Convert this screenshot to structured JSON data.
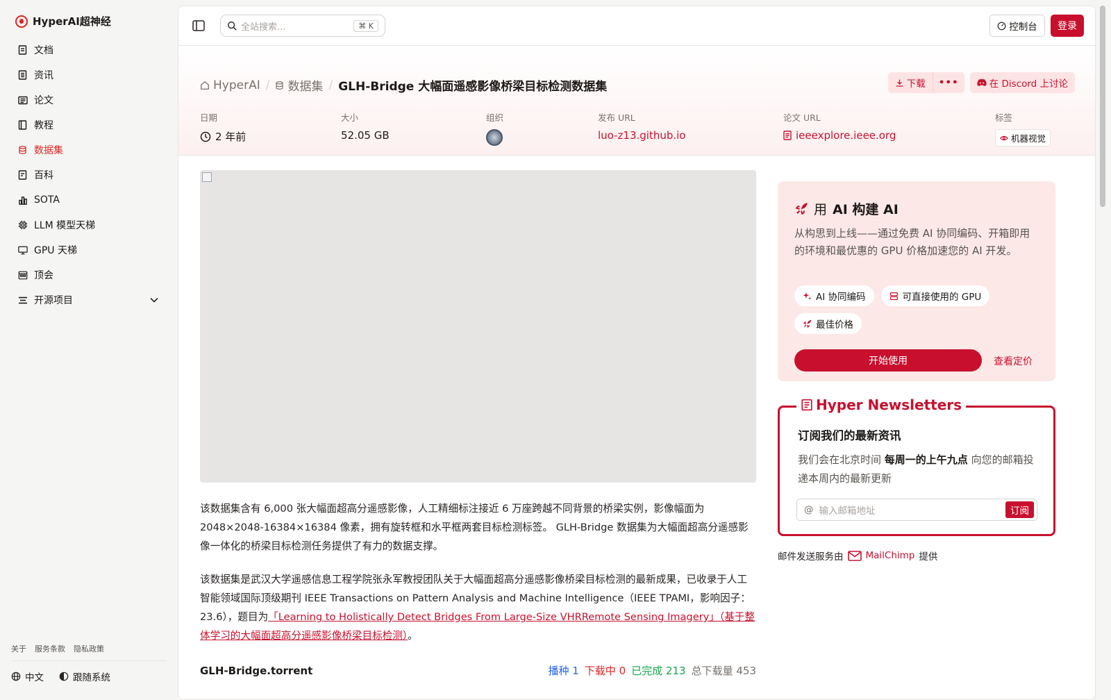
{
  "app": {
    "name": "HyperAI超神经"
  },
  "sidebar": {
    "items": [
      {
        "label": "文档",
        "icon": "doc-icon"
      },
      {
        "label": "资讯",
        "icon": "news-icon"
      },
      {
        "label": "论文",
        "icon": "paper-icon"
      },
      {
        "label": "教程",
        "icon": "book-icon"
      },
      {
        "label": "数据集",
        "icon": "database-icon",
        "active": true
      },
      {
        "label": "百科",
        "icon": "wiki-icon"
      },
      {
        "label": "SOTA",
        "icon": "bar-chart-icon"
      },
      {
        "label": "LLM 模型天梯",
        "icon": "cpu-icon"
      },
      {
        "label": "GPU 天梯",
        "icon": "monitor-icon"
      },
      {
        "label": "顶会",
        "icon": "calendar-icon"
      },
      {
        "label": "开源项目",
        "icon": "list-icon",
        "expandable": true
      }
    ],
    "footer_links": [
      "关于",
      "服务条款",
      "隐私政策"
    ],
    "language": "中文",
    "theme": "跟随系统"
  },
  "topbar": {
    "search_placeholder": "全站搜索...",
    "search_shortcut": "K",
    "console_label": "控制台",
    "login_label": "登录"
  },
  "breadcrumb": {
    "home": "HyperAI",
    "section": "数据集",
    "current": "GLH-Bridge 大幅面遥感影像桥梁目标检测数据集"
  },
  "actions": {
    "download_label": "下载",
    "more_label": "•••",
    "discord_label": "在 Discord 上讨论"
  },
  "meta": {
    "date_label": "日期",
    "date_value": "2 年前",
    "size_label": "大小",
    "size_value": "52.05 GB",
    "org_label": "组织",
    "publish_label": "发布 URL",
    "publish_value": "luo-z13.github.io",
    "paper_label": "论文 URL",
    "paper_value": "ieeexplore.ieee.org",
    "tags_label": "标签",
    "tag_value": "机器视觉"
  },
  "description": {
    "p1": "该数据集含有 6,000 张大幅面超高分遥感影像，人工精细标注接近 6 万座跨越不同背景的桥梁实例，影像幅面为 2048×2048-16384×16384 像素，拥有旋转框和水平框两套目标检测标签。 GLH-Bridge 数据集为大幅面超高分遥感影像一体化的桥梁目标检测任务提供了有力的数据支撑。",
    "p2_prefix": "该数据集是武汉大学遥感信息工程学院张永军教授团队关于大幅面超高分遥感影像桥梁目标检测的最新成果，已收录于人工智能领域国际顶级期刊 IEEE Transactions on Pattern Analysis and Machine Intelligence（IEEE TPAMI，影响因子：23.6），题目为",
    "p2_link": "「Learning to Holistically Detect Bridges From Large-Size VHRRemote Sensing Imagery」（基于整体学习的大幅面超高分遥感影像桥梁目标检测）",
    "p2_suffix": "。"
  },
  "torrent": {
    "name": "GLH-Bridge.torrent",
    "seed_label": "播种",
    "seed": "1",
    "downloading_label": "下载中",
    "downloading": "0",
    "done_label": "已完成",
    "done": "213",
    "total_label": "总下载量",
    "total": "453"
  },
  "promo": {
    "title_prefix": "用",
    "title_main": "AI 构建 AI",
    "body": "从构思到上线——通过免费 AI 协同编码、开箱即用的环境和最优惠的 GPU 价格加速您的 AI 开发。",
    "chips": [
      "AI 协同编码",
      "可直接使用的 GPU",
      "最佳价格"
    ],
    "start_label": "开始使用",
    "pricing_label": "查看定价"
  },
  "newsletter": {
    "title": "Hyper Newsletters",
    "heading": "订阅我们的最新资讯",
    "body_prefix": "我们会在北京时间",
    "body_bold": "每周一的上午九点",
    "body_suffix": "向您的邮箱投递本周内的最新更新",
    "email_placeholder": "输入邮箱地址",
    "subscribe_label": "订阅"
  },
  "mail_service": {
    "prefix": "邮件发送服务由",
    "provider": "MailChimp",
    "suffix": "提供"
  },
  "colors": {
    "accent": "#c8102e",
    "sidebar_bg": "#f5f5f4"
  }
}
